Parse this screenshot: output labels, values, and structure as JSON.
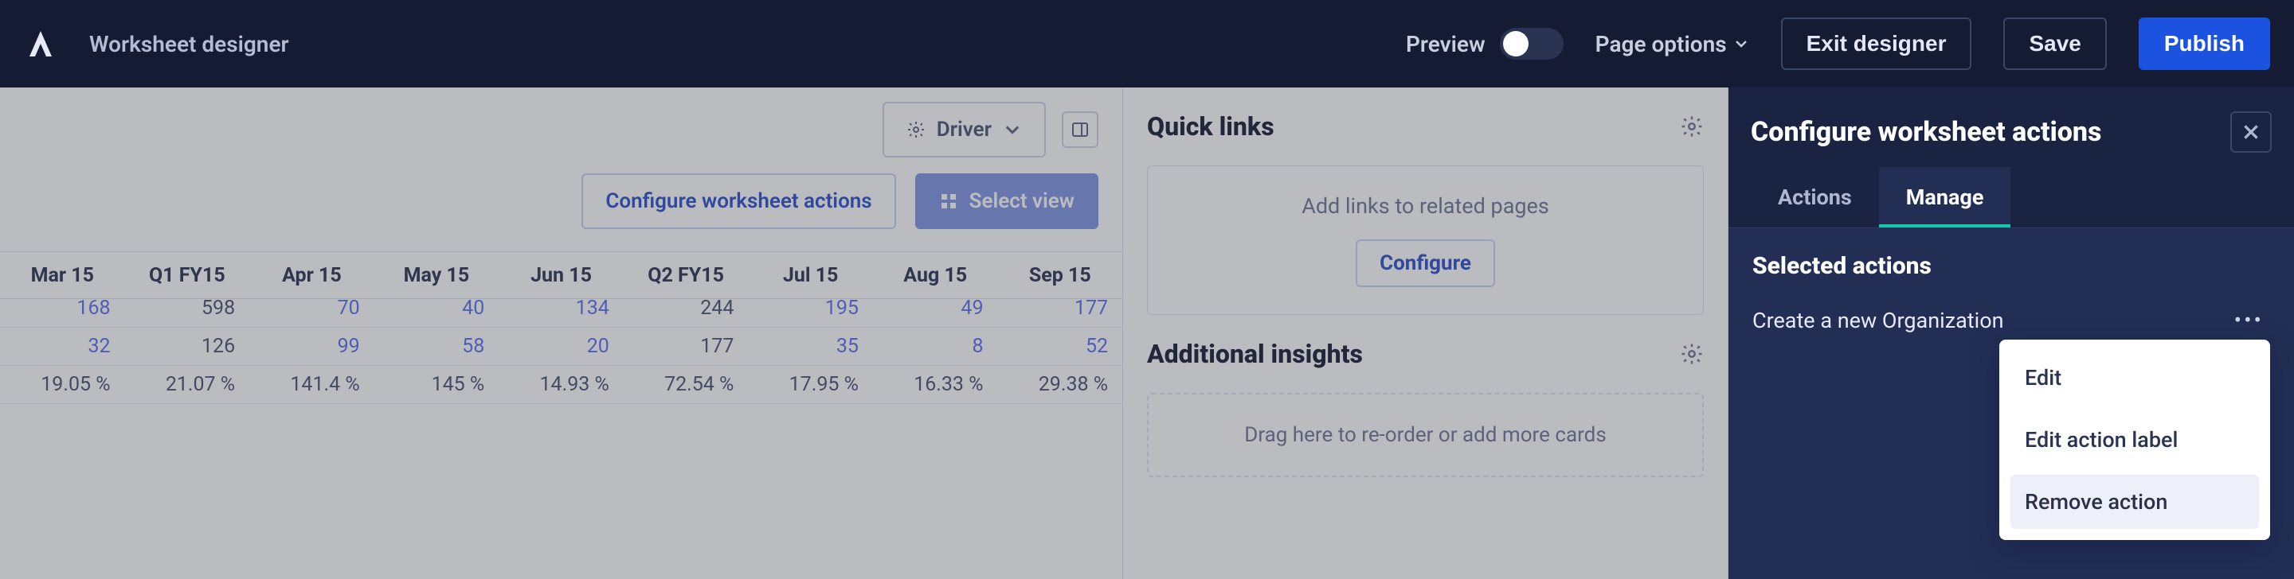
{
  "header": {
    "title": "Worksheet designer",
    "preview_label": "Preview",
    "page_options_label": "Page options",
    "exit_label": "Exit designer",
    "save_label": "Save",
    "publish_label": "Publish"
  },
  "worksheet": {
    "driver_label": "Driver",
    "configure_actions_label": "Configure worksheet actions",
    "select_view_label": "Select view",
    "columns": [
      "Mar 15",
      "Q1 FY15",
      "Apr 15",
      "May 15",
      "Jun 15",
      "Q2 FY15",
      "Jul 15",
      "Aug 15",
      "Sep 15"
    ],
    "rows": [
      {
        "vals": [
          "168",
          "598",
          "70",
          "40",
          "134",
          "244",
          "195",
          "49",
          "177"
        ],
        "link_cols": [
          0,
          2,
          3,
          4,
          6,
          7,
          8
        ]
      },
      {
        "vals": [
          "32",
          "126",
          "99",
          "58",
          "20",
          "177",
          "35",
          "8",
          "52"
        ],
        "link_cols": [
          0,
          2,
          3,
          4,
          6,
          7,
          8
        ]
      },
      {
        "vals": [
          "19.05 %",
          "21.07 %",
          "141.4 %",
          "145 %",
          "14.93 %",
          "72.54 %",
          "17.95 %",
          "16.33 %",
          "29.38 %"
        ],
        "link_cols": []
      }
    ]
  },
  "quicklinks": {
    "title": "Quick links",
    "hint": "Add links to related pages",
    "configure_label": "Configure"
  },
  "insights": {
    "title": "Additional insights",
    "drag_hint": "Drag here to re-order or add more cards"
  },
  "panel": {
    "title": "Configure worksheet actions",
    "tabs": [
      "Actions",
      "Manage"
    ],
    "active_tab": 1,
    "subheading": "Selected actions",
    "selected_action": "Create a new Organization",
    "menu": {
      "edit": "Edit",
      "edit_label": "Edit action label",
      "remove": "Remove action"
    }
  }
}
